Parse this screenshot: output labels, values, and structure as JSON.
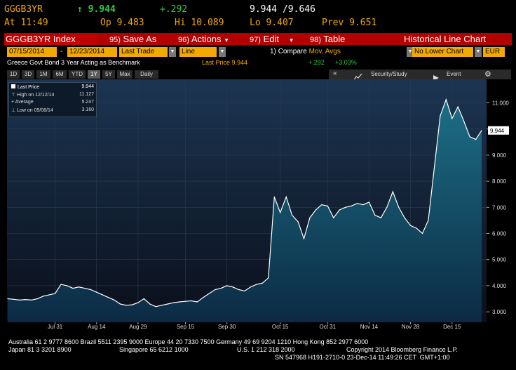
{
  "quote": {
    "ticker": "GGGB3YR",
    "last": "9.944",
    "change": "+.292",
    "bid_ask": "9.944 /9.646",
    "at_label": "At",
    "at_time": "11:49",
    "open_label": "Op",
    "open": "9.483",
    "hi_label": "Hi",
    "hi": "10.089",
    "lo_label": "Lo",
    "lo": "9.407",
    "prev_label": "Prev",
    "prev": "9.651"
  },
  "toolbar": {
    "title": "GGGB3YR Index",
    "save_num": "95)",
    "save_label": "Save As",
    "actions_num": "96)",
    "actions_label": "Actions",
    "edit_num": "97)",
    "edit_label": "Edit",
    "table_num": "98)",
    "table_label": "Table",
    "chart_title": "Historical Line Chart"
  },
  "controls": {
    "start_date": "07/15/2014",
    "dash": "-",
    "end_date": "12/23/2014",
    "field": "Last Trade",
    "style": "Line",
    "compare_num": "1)",
    "compare_label": "Compare",
    "compare_value": "Mov. Avgs",
    "lower_chart": "No Lower Chart",
    "currency": "EUR"
  },
  "security": {
    "description": "Greece Govt Bond 3 Year Acting as Benchmark",
    "last_price_label": "Last Price 9.944",
    "net_change": "+.292",
    "pct_change": "+3.03%"
  },
  "periods": [
    {
      "label": "1D",
      "selected": false
    },
    {
      "label": "3D",
      "selected": false
    },
    {
      "label": "1M",
      "selected": false
    },
    {
      "label": "6M",
      "selected": false
    },
    {
      "label": "YTD",
      "selected": false
    },
    {
      "label": "1Y",
      "selected": true
    },
    {
      "label": "5Y",
      "selected": false
    },
    {
      "label": "Max",
      "selected": false
    },
    {
      "label": "Daily",
      "selected": false
    }
  ],
  "right_tools": {
    "collapse": "«",
    "security_study": "Security/Study",
    "event": "Event",
    "settings_icon": "gear-icon"
  },
  "legend": {
    "last_price_label": "Last Price",
    "last_price_value": "9.944",
    "high_label": "High on 12/12/14",
    "high_value": "11.127",
    "average_label": "Average",
    "average_value": "5.247",
    "low_label": "Low on 09/08/14",
    "low_value": "3.160"
  },
  "chart_data": {
    "type": "area",
    "x": [
      "07/15",
      "07/17",
      "07/19",
      "07/21",
      "07/23",
      "07/25",
      "07/27",
      "07/29",
      "07/31",
      "08/02",
      "08/04",
      "08/06",
      "08/08",
      "08/10",
      "08/12",
      "08/14",
      "08/16",
      "08/18",
      "08/20",
      "08/22",
      "08/24",
      "08/26",
      "08/28",
      "08/30",
      "09/01",
      "09/03",
      "09/05",
      "09/07",
      "09/09",
      "09/11",
      "09/13",
      "09/15",
      "09/17",
      "09/19",
      "09/21",
      "09/23",
      "09/25",
      "09/27",
      "09/29",
      "10/01",
      "10/03",
      "10/05",
      "10/07",
      "10/09",
      "10/11",
      "10/13",
      "10/15",
      "10/17",
      "10/19",
      "10/21",
      "10/23",
      "10/25",
      "10/27",
      "10/29",
      "10/31",
      "11/02",
      "11/04",
      "11/06",
      "11/08",
      "11/10",
      "11/12",
      "11/14",
      "11/16",
      "11/18",
      "11/20",
      "11/22",
      "11/24",
      "11/26",
      "11/28",
      "11/30",
      "12/02",
      "12/04",
      "12/06",
      "12/08",
      "12/10",
      "12/12",
      "12/14",
      "12/16",
      "12/18",
      "12/20",
      "12/23"
    ],
    "values": [
      3.5,
      3.48,
      3.45,
      3.47,
      3.45,
      3.5,
      3.6,
      3.65,
      3.7,
      4.05,
      4.0,
      3.9,
      3.95,
      3.9,
      3.85,
      3.75,
      3.65,
      3.55,
      3.45,
      3.3,
      3.25,
      3.27,
      3.35,
      3.5,
      3.3,
      3.2,
      3.25,
      3.3,
      3.35,
      3.38,
      3.4,
      3.42,
      3.38,
      3.55,
      3.7,
      3.85,
      3.9,
      4.0,
      3.95,
      3.85,
      3.8,
      3.95,
      4.05,
      4.1,
      4.3,
      7.4,
      6.8,
      7.4,
      6.7,
      6.45,
      5.8,
      6.6,
      6.9,
      7.1,
      7.05,
      6.6,
      6.9,
      7.0,
      7.05,
      7.15,
      7.1,
      7.2,
      6.7,
      6.6,
      7.0,
      7.6,
      7.0,
      6.6,
      6.3,
      6.2,
      6.0,
      6.5,
      8.5,
      10.5,
      11.127,
      10.4,
      10.85,
      10.3,
      9.7,
      9.6,
      9.944
    ],
    "x_ticks": [
      "Jul 31",
      "Aug 14",
      "Aug 29",
      "Sep 15",
      "Sep 30",
      "Oct 15",
      "Oct 31",
      "Nov 14",
      "Nov 28",
      "Dec 15"
    ],
    "x_year": "2014",
    "y_ticks": [
      "3.000",
      "4.000",
      "5.000",
      "6.000",
      "7.000",
      "8.000",
      "9.000",
      "10.000",
      "11.000"
    ],
    "ylim": [
      2.6,
      11.9
    ],
    "last_value_label": "9.944",
    "grid": true,
    "legend_position": "top-left"
  },
  "footer": {
    "line1": "Australia 61 2 9777 8600 Brazil 5511 2395 9000 Europe 44 20 7330 7500 Germany 49 69 9204 1210 Hong Kong 852 2977 6000",
    "line2_left": "Japan 81 3 3201 8900",
    "line2_mid": "Singapore 65 6212 1000",
    "line2_us": "U.S. 1 212 318 2000",
    "line2_right": "Copyright 2014 Bloomberg Finance L.P.",
    "line3": "SN 547968 H191-2710-0 23-Dec-14 11:49:26 CET  GMT+1:00"
  },
  "colors": {
    "toolbar": "#b30000",
    "accent_yellow": "#f2a900",
    "up_green": "#2ecc40",
    "chart_bg_top": "#1c3552",
    "area_fill": "#16506a"
  }
}
